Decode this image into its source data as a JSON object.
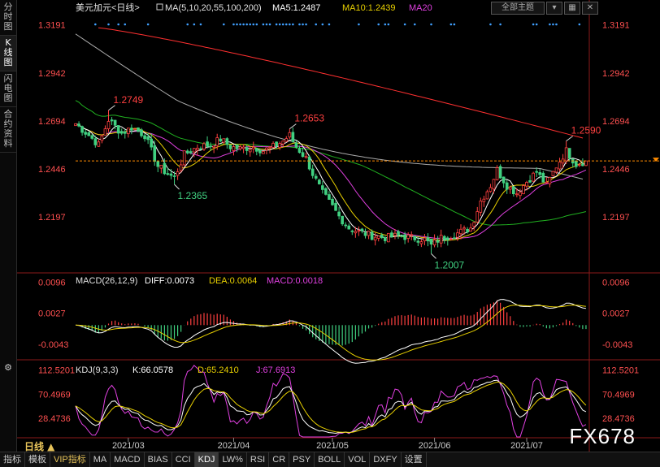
{
  "sidebar": {
    "tabs": [
      {
        "label": "分时图",
        "active": false
      },
      {
        "label": "K线图",
        "active": true
      },
      {
        "label": "闪电图",
        "active": false
      },
      {
        "label": "合约资料",
        "active": false
      }
    ]
  },
  "top_buttons": {
    "all_themes": "全部主题",
    "icons": [
      "list-icon",
      "close-icon"
    ]
  },
  "bottom_tabs": [
    "指标",
    "模板",
    "VIP指标",
    "MA",
    "MACD",
    "BIAS",
    "CCI",
    "KDJ",
    "LW%",
    "RSI",
    "CR",
    "PSY",
    "BOLL",
    "VOL",
    "DXFY",
    "设置"
  ],
  "bottom_active": "KDJ",
  "period_label": "日线 ▲",
  "watermark": "FX678",
  "colors": {
    "up": "#ff4040",
    "down": "#40d080",
    "ma5": "#ffffff",
    "ma10": "#e8d000",
    "ma20": "#e040e0",
    "ma55": "#20b020",
    "ma100": "#aaaaaa",
    "ma200": "#ff3030",
    "price_line": "#ff8c00",
    "blue_marks": "#40a0ff"
  },
  "chart_data": {
    "type": "candlestick",
    "main": {
      "legend": {
        "symbol": "美元加元<日线>",
        "ma_spec": "MA(5,10,20,55,100,200)",
        "ma5": "MA5:1.2487",
        "ma10": "MA10:1.2439",
        "ma20": "MA20"
      },
      "y_ticks": [
        "1.3191",
        "1.2942",
        "1.2694",
        "1.2446",
        "1.2197"
      ],
      "ylim": [
        1.1916,
        1.3244
      ],
      "current_price": 1.2487,
      "annotations": [
        {
          "label": "1.2749",
          "index": 10,
          "price": 1.2749,
          "kind": "high"
        },
        {
          "label": "1.2365",
          "index": 30,
          "price": 1.2365,
          "kind": "low"
        },
        {
          "label": "1.2653",
          "index": 65,
          "price": 1.2653,
          "kind": "high"
        },
        {
          "label": "1.2007",
          "index": 108,
          "price": 1.2007,
          "kind": "low"
        },
        {
          "label": "1.2590",
          "index": 149,
          "price": 1.259,
          "kind": "high"
        }
      ],
      "ma55_end": 1.2225,
      "ma100_start": 1.3044,
      "ma100_end": 1.2389,
      "ma200_start": 1.3176,
      "ma200_end": 1.2601
    },
    "macd": {
      "legend": {
        "spec": "MACD(26,12,9)",
        "diff": "DIFF:0.0073",
        "dea": "DEA:0.0064",
        "macd": "MACD:0.0018"
      },
      "y_ticks": [
        "0.0096",
        "0.0027",
        "-0.0043"
      ],
      "ylim": [
        -0.0072,
        0.0113
      ]
    },
    "kdj": {
      "legend": {
        "spec": "KDJ(9,3,3)",
        "k": "K:66.0578",
        "d": "D:65.2410",
        "j": "J:67.6913"
      },
      "y_ticks": [
        "112.5201",
        "70.4969",
        "28.4736"
      ],
      "ylim": [
        -4,
        126
      ]
    },
    "x_ticks": [
      {
        "label": "2021/03",
        "index": 16
      },
      {
        "label": "2021/04",
        "index": 48
      },
      {
        "label": "2021/05",
        "index": 78
      },
      {
        "label": "2021/06",
        "index": 109
      },
      {
        "label": "2021/07",
        "index": 137
      }
    ],
    "waypoints": [
      [
        0,
        1.268
      ],
      [
        4,
        1.262
      ],
      [
        7,
        1.257
      ],
      [
        10,
        1.27
      ],
      [
        14,
        1.263
      ],
      [
        17,
        1.266
      ],
      [
        21,
        1.262
      ],
      [
        25,
        1.246
      ],
      [
        28,
        1.242
      ],
      [
        30,
        1.24
      ],
      [
        33,
        1.252
      ],
      [
        37,
        1.256
      ],
      [
        41,
        1.257
      ],
      [
        44,
        1.26
      ],
      [
        47,
        1.256
      ],
      [
        50,
        1.255
      ],
      [
        54,
        1.256
      ],
      [
        57,
        1.254
      ],
      [
        60,
        1.256
      ],
      [
        63,
        1.259
      ],
      [
        65,
        1.262
      ],
      [
        67,
        1.256
      ],
      [
        70,
        1.25
      ],
      [
        72,
        1.242
      ],
      [
        75,
        1.232
      ],
      [
        78,
        1.225
      ],
      [
        80,
        1.22
      ],
      [
        83,
        1.214
      ],
      [
        86,
        1.212
      ],
      [
        90,
        1.21
      ],
      [
        94,
        1.209
      ],
      [
        98,
        1.21
      ],
      [
        102,
        1.209
      ],
      [
        106,
        1.208
      ],
      [
        108,
        1.205
      ],
      [
        111,
        1.209
      ],
      [
        114,
        1.21
      ],
      [
        117,
        1.212
      ],
      [
        120,
        1.214
      ],
      [
        123,
        1.228
      ],
      [
        126,
        1.236
      ],
      [
        128,
        1.244
      ],
      [
        131,
        1.236
      ],
      [
        134,
        1.232
      ],
      [
        137,
        1.238
      ],
      [
        140,
        1.243
      ],
      [
        143,
        1.236
      ],
      [
        146,
        1.246
      ],
      [
        149,
        1.254
      ],
      [
        152,
        1.247
      ],
      [
        155,
        1.2487
      ]
    ],
    "n_bars": 156
  }
}
